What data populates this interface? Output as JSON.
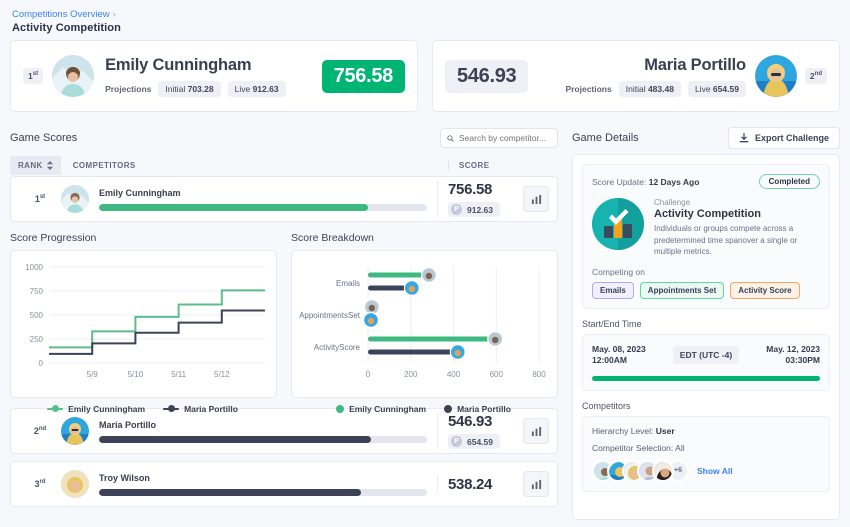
{
  "breadcrumb": {
    "parent": "Competitions Overview",
    "separator": "›",
    "title": "Activity Competition"
  },
  "leaders": [
    {
      "rank": "1",
      "rank_suffix": "st",
      "name": "Emily Cunningham",
      "score": "756.58",
      "score_style": "green",
      "projections_label": "Projections",
      "initial_label": "Initial",
      "initial_value": "703.28",
      "live_label": "Live",
      "live_value": "912.63"
    },
    {
      "rank": "2",
      "rank_suffix": "nd",
      "name": "Maria Portillo",
      "score": "546.93",
      "score_style": "grey",
      "projections_label": "Projections",
      "initial_label": "Initial",
      "initial_value": "483.48",
      "live_label": "Live",
      "live_value": "654.59"
    }
  ],
  "game_scores": {
    "title": "Game Scores",
    "search_placeholder": "Search by competitor...",
    "columns": {
      "rank": "RANK",
      "competitors": "COMPETITORS",
      "score": "SCORE"
    },
    "rows": [
      {
        "rank": "1",
        "rank_suffix": "st",
        "name": "Emily Cunningham",
        "score": "756.58",
        "projection": "912.63",
        "projection_initial": "P",
        "bar_pct": 82,
        "bar_color": "#3fb982"
      },
      {
        "rank": "2",
        "rank_suffix": "nd",
        "name": "Maria Portillo",
        "score": "546.93",
        "projection": "654.59",
        "projection_initial": "P",
        "bar_pct": 83,
        "bar_color": "#3c4358"
      },
      {
        "rank": "3",
        "rank_suffix": "rd",
        "name": "Troy Wilson",
        "score": "538.24",
        "projection": "",
        "projection_initial": "P",
        "bar_pct": 80,
        "bar_color": "#3c4358"
      }
    ]
  },
  "charts": {
    "progression_title": "Score Progression",
    "breakdown_title": "Score Breakdown"
  },
  "chart_data": [
    {
      "type": "line",
      "title": "Score Progression",
      "xlabel": "",
      "ylabel": "",
      "ylim": [
        0,
        1000
      ],
      "yticks": [
        0,
        250,
        500,
        750,
        1000
      ],
      "xticks": [
        "5/9",
        "5/10",
        "5/11",
        "5/12"
      ],
      "grid": true,
      "legend_position": "bottom",
      "step": true,
      "series": [
        {
          "name": "Emily Cunningham",
          "color": "#5bbd8c",
          "x": [
            "5/8",
            "5/9",
            "5/10",
            "5/11",
            "5/12",
            "5/13"
          ],
          "values": [
            163,
            330,
            480,
            610,
            756,
            756
          ]
        },
        {
          "name": "Maria Portillo",
          "color": "#3c4358",
          "x": [
            "5/8",
            "5/9",
            "5/10",
            "5/11",
            "5/12",
            "5/13"
          ],
          "values": [
            95,
            205,
            315,
            420,
            547,
            547
          ]
        }
      ]
    },
    {
      "type": "bar",
      "title": "Score Breakdown",
      "orientation": "horizontal",
      "categories": [
        "Emails",
        "AppointmentsSet",
        "ActivityScore"
      ],
      "xlim": [
        0,
        800
      ],
      "xticks": [
        0,
        200,
        400,
        600,
        800
      ],
      "grid": true,
      "legend_position": "bottom",
      "series": [
        {
          "name": "Emily Cunningham",
          "color": "#3fb982",
          "values": [
            285,
            18,
            595
          ]
        },
        {
          "name": "Maria Portillo",
          "color": "#3c4358",
          "values": [
            205,
            14,
            420
          ]
        }
      ]
    }
  ],
  "game_details": {
    "title": "Game Details",
    "export_label": "Export Challenge",
    "score_update_label": "Score Update:",
    "score_update_value": "12 Days Ago",
    "status": "Completed",
    "challenge_label": "Challenge",
    "challenge_title": "Activity Competition",
    "challenge_desc": "Individuals or groups compete across a predetermined time spanover a single or multiple metrics.",
    "competing_on_label": "Competing on",
    "metrics": [
      {
        "label": "Emails",
        "style": "purple"
      },
      {
        "label": "Appointments Set",
        "style": "green"
      },
      {
        "label": "Activity Score",
        "style": "orange"
      }
    ],
    "time_label": "Start/End Time",
    "start_date": "May. 08, 2023",
    "start_time": "12:00AM",
    "timezone": "EDT (UTC -4)",
    "end_date": "May. 12, 2023",
    "end_time": "03:30PM",
    "progress_pct": 100,
    "competitors_label": "Competitors",
    "hierarchy_label": "Hierarchy Level:",
    "hierarchy_value": "User",
    "selection_label": "Competitor Selection:",
    "selection_value": "All",
    "more_count": "+6",
    "show_all": "Show All"
  },
  "colors": {
    "accent_green": "#00b473",
    "dark_navy": "#3c4358",
    "link_blue": "#3b82f6",
    "teal": "#17b3ae"
  },
  "icons": {
    "search": "search-icon",
    "sort": "sort-icon",
    "download": "download-icon",
    "chart": "chart-icon"
  }
}
